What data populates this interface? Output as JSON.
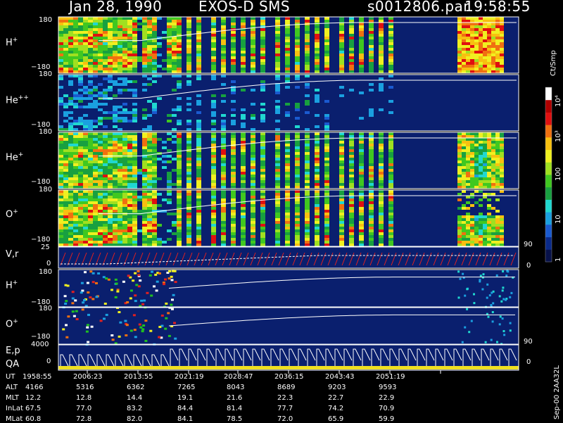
{
  "header": {
    "date": "Jan 28, 1990",
    "instrument": "EXOS-D SMS",
    "file": "s0012806.par",
    "time": "19:58:55"
  },
  "panels": [
    {
      "label": "H",
      "sup": "+",
      "tick_top": "180",
      "tick_bot": "−180"
    },
    {
      "label": "He",
      "sup": "++",
      "tick_top": "180",
      "tick_bot": "−180"
    },
    {
      "label": "He",
      "sup": "+",
      "tick_top": "180",
      "tick_bot": "−180"
    },
    {
      "label": "O",
      "sup": "+",
      "tick_top": "180",
      "tick_bot": "−180"
    },
    {
      "label": "V,r",
      "sup": "",
      "tick_top": "25",
      "tick_bot": "0"
    },
    {
      "label": "H",
      "sup": "+",
      "tick_top": "180",
      "tick_bot": "−180"
    },
    {
      "label": "O",
      "sup": "+",
      "tick_top": "180",
      "tick_bot": "−180"
    },
    {
      "label": "E,p",
      "sup": "",
      "tick_top": "4000",
      "tick_bot": "0"
    }
  ],
  "qa_label": "QA",
  "right_ticks": {
    "a_90": "90",
    "a_0": "0",
    "b_90": "90",
    "b_0": "0",
    "c_0": "0"
  },
  "colorbar": {
    "unit": "Ct/Smp",
    "labels": [
      "1",
      "10",
      "100",
      "10³",
      "10⁴"
    ],
    "colors": [
      "#08124a",
      "#0a2a8a",
      "#1a5ad0",
      "#1aa0e0",
      "#20d8d0",
      "#18a040",
      "#40c820",
      "#a0e020",
      "#f0f020",
      "#f8c010",
      "#f07010",
      "#e01010",
      "#b00000",
      "#ffffff"
    ]
  },
  "side_note": "Sep-00  2AA32L",
  "ephemeris": {
    "rows": [
      {
        "name": "UT",
        "values": [
          "1958:55",
          "2006:23",
          "2013:55",
          "2021:19",
          "2028:47",
          "2036:15",
          "2043:43",
          "2051:19"
        ]
      },
      {
        "name": "ALT",
        "values": [
          "4166",
          "5316",
          "6362",
          "7265",
          "8043",
          "8689",
          "9203",
          "9593"
        ]
      },
      {
        "name": "MLT",
        "values": [
          "12.2",
          "12.8",
          "14.4",
          "19.1",
          "21.6",
          "22.3",
          "22.7",
          "22.9"
        ]
      },
      {
        "name": "InLat",
        "values": [
          "67.5",
          "77.0",
          "83.2",
          "84.4",
          "81.4",
          "77.7",
          "74.2",
          "70.9"
        ]
      },
      {
        "name": "MLat",
        "values": [
          "60.8",
          "72.8",
          "82.0",
          "84.1",
          "78.5",
          "72.0",
          "65.9",
          "59.9"
        ]
      }
    ]
  },
  "chart_data": {
    "type": "heatmap",
    "title": "Jan 28, 1990   EXOS-D SMS",
    "x_ticks": [
      "1958:55",
      "2006:23",
      "2013:55",
      "2021:19",
      "2028:47",
      "2036:15",
      "2043:43",
      "2051:19"
    ],
    "colorbar_label": "Ct/Smp",
    "colorbar_ticks": [
      "1",
      "10",
      "100",
      "10³",
      "10⁴"
    ],
    "colorscale": "log",
    "series": [
      {
        "name": "H⁺",
        "ylim": [
          -180,
          180
        ]
      },
      {
        "name": "He⁺⁺",
        "ylim": [
          -180,
          180
        ]
      },
      {
        "name": "He⁺",
        "ylim": [
          -180,
          180
        ]
      },
      {
        "name": "O⁺",
        "ylim": [
          -180,
          180
        ]
      },
      {
        "name": "V,r",
        "ylim": [
          0,
          25
        ]
      },
      {
        "name": "H⁺",
        "ylim": [
          -180,
          180
        ]
      },
      {
        "name": "O⁺",
        "ylim": [
          -180,
          180
        ]
      },
      {
        "name": "E,p",
        "ylim": [
          0,
          4000
        ]
      }
    ]
  }
}
